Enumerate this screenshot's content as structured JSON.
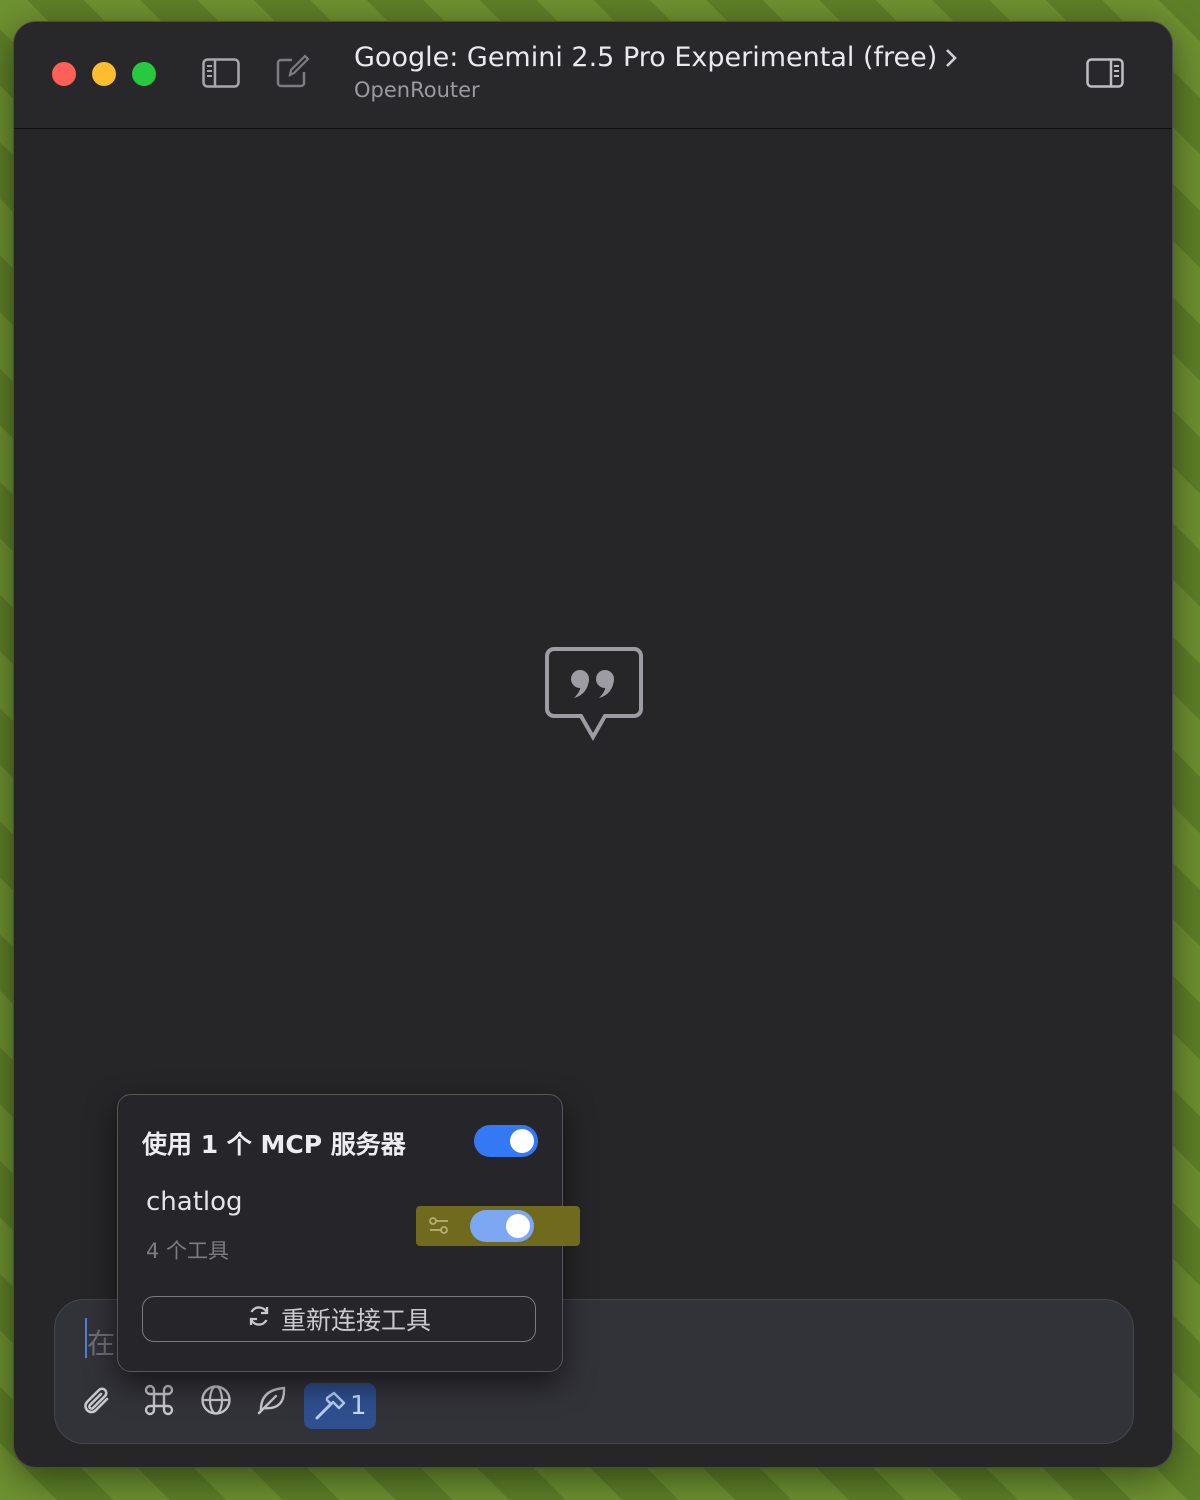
{
  "header": {
    "title": "Google: Gemini 2.5 Pro Experimental (free)",
    "subtitle": "OpenRouter"
  },
  "composer": {
    "placeholder": "在",
    "active_tools_count": "1"
  },
  "mcp_popover": {
    "title": "使用 1 个 MCP 服务器",
    "enabled": true,
    "server": {
      "name": "chatlog",
      "tools": "4 个工具",
      "enabled": true
    },
    "reconnect_label": "重新连接工具"
  },
  "colors": {
    "accent": "#3478f6",
    "window_bg": "#262629",
    "highlight": "#6f6a1e"
  }
}
